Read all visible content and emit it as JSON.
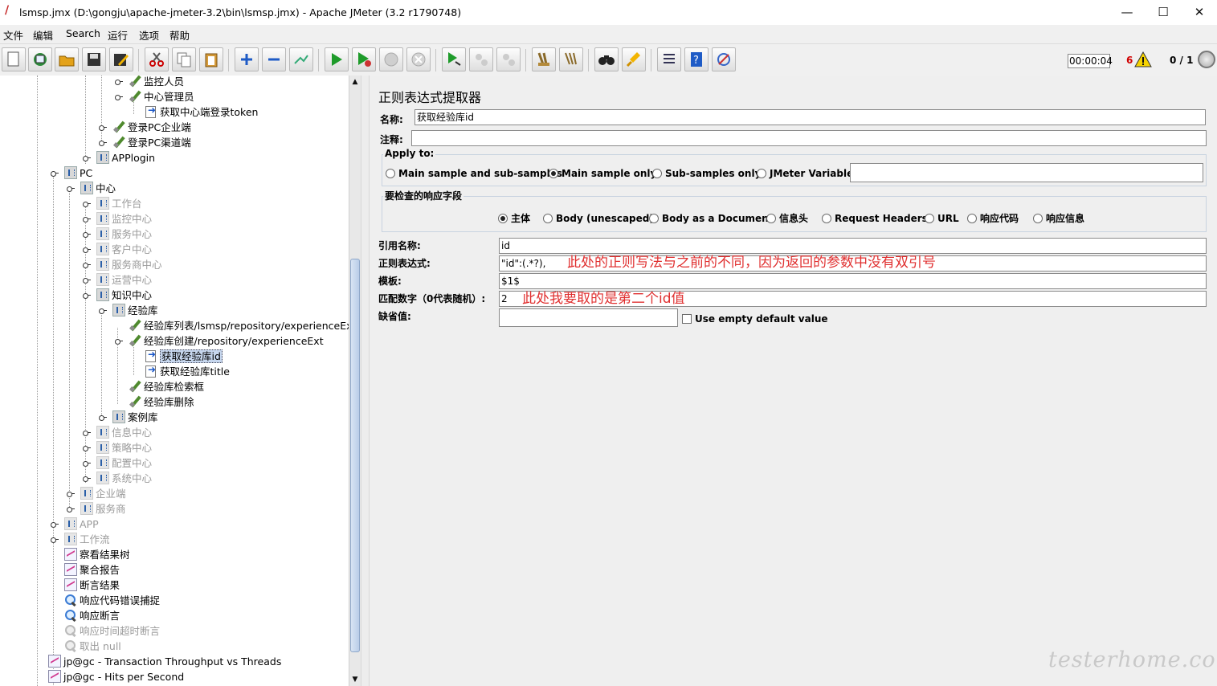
{
  "window": {
    "title": "lsmsp.jmx (D:\\gongju\\apache-jmeter-3.2\\bin\\lsmsp.jmx) - Apache JMeter (3.2 r1790748)",
    "minimize": "—",
    "maximize": "☐",
    "close": "✕"
  },
  "menu": [
    "文件",
    "编辑",
    "Search",
    "运行",
    "选项",
    "帮助"
  ],
  "toolbar": {
    "buttons": [
      "new",
      "templates",
      "open",
      "save",
      "save-as",
      "cut",
      "copy",
      "paste",
      "expand",
      "collapse",
      "toggle",
      "start",
      "start-no-pause",
      "stop",
      "shutdown",
      "remote-start",
      "remote-stop",
      "remote-shutdown",
      "clear",
      "clear-all",
      "search",
      "reset-search",
      "function-helper",
      "help",
      "log-viewer"
    ],
    "elapsed": "00:00:04",
    "warning_count": "6",
    "threads": "0 / 1"
  },
  "tree": {
    "nodes": [
      {
        "label": "监控人员",
        "icon": "pen-icon",
        "disabled": false,
        "expander": true
      },
      {
        "label": "中心管理员",
        "icon": "pen-icon",
        "disabled": false,
        "expander": true
      },
      {
        "label": "获取中心端登录token",
        "icon": "extractor-icon",
        "disabled": false,
        "expander": false
      },
      {
        "label": "登录PC企业端",
        "icon": "pen-icon",
        "disabled": false,
        "expander": true
      },
      {
        "label": "登录PC渠道端",
        "icon": "pen-icon",
        "disabled": false,
        "expander": true
      },
      {
        "label": "APPlogin",
        "icon": "controller-icon",
        "disabled": false,
        "expander": true
      },
      {
        "label": "PC",
        "icon": "controller-icon",
        "disabled": false,
        "expander": true
      },
      {
        "label": "中心",
        "icon": "controller-icon",
        "disabled": false,
        "expander": true
      },
      {
        "label": "工作台",
        "icon": "controller-icon",
        "disabled": true,
        "expander": true
      },
      {
        "label": "监控中心",
        "icon": "controller-icon",
        "disabled": true,
        "expander": true
      },
      {
        "label": "服务中心",
        "icon": "controller-icon",
        "disabled": true,
        "expander": true
      },
      {
        "label": "客户中心",
        "icon": "controller-icon",
        "disabled": true,
        "expander": true
      },
      {
        "label": "服务商中心",
        "icon": "controller-icon",
        "disabled": true,
        "expander": true
      },
      {
        "label": "运营中心",
        "icon": "controller-icon",
        "disabled": true,
        "expander": true
      },
      {
        "label": "知识中心",
        "icon": "controller-icon",
        "disabled": false,
        "expander": true
      },
      {
        "label": "经验库",
        "icon": "controller-icon",
        "disabled": false,
        "expander": true
      },
      {
        "label": "经验库列表/lsmsp/repository/experienceExt",
        "icon": "pen-icon",
        "disabled": false,
        "expander": false
      },
      {
        "label": "经验库创建/repository/experienceExt",
        "icon": "pen-icon",
        "disabled": false,
        "expander": true
      },
      {
        "label": "获取经验库id",
        "icon": "extractor-icon",
        "disabled": false,
        "expander": false,
        "selected": true
      },
      {
        "label": "获取经验库title",
        "icon": "extractor-icon",
        "disabled": false,
        "expander": false
      },
      {
        "label": "经验库检索框",
        "icon": "pen-icon",
        "disabled": false,
        "expander": false
      },
      {
        "label": "经验库删除",
        "icon": "pen-icon",
        "disabled": false,
        "expander": false
      },
      {
        "label": "案例库",
        "icon": "controller-icon",
        "disabled": false,
        "expander": true
      },
      {
        "label": "信息中心",
        "icon": "controller-icon",
        "disabled": true,
        "expander": true
      },
      {
        "label": "策略中心",
        "icon": "controller-icon",
        "disabled": true,
        "expander": true
      },
      {
        "label": "配置中心",
        "icon": "controller-icon",
        "disabled": true,
        "expander": true
      },
      {
        "label": "系统中心",
        "icon": "controller-icon",
        "disabled": true,
        "expander": true
      },
      {
        "label": "企业端",
        "icon": "controller-icon",
        "disabled": true,
        "expander": true
      },
      {
        "label": "服务商",
        "icon": "controller-icon",
        "disabled": true,
        "expander": true
      },
      {
        "label": "APP",
        "icon": "controller-icon",
        "disabled": true,
        "expander": true
      },
      {
        "label": "工作流",
        "icon": "controller-icon",
        "disabled": true,
        "expander": true
      },
      {
        "label": "察看结果树",
        "icon": "chart-icon",
        "disabled": false,
        "expander": false
      },
      {
        "label": "聚合报告",
        "icon": "chart-icon",
        "disabled": false,
        "expander": false
      },
      {
        "label": "断言结果",
        "icon": "chart-icon",
        "disabled": false,
        "expander": false
      },
      {
        "label": "响应代码错误捕捉",
        "icon": "magnifier-icon",
        "disabled": false,
        "expander": false
      },
      {
        "label": "响应断言",
        "icon": "magnifier-icon",
        "disabled": false,
        "expander": false
      },
      {
        "label": "响应时间超时断言",
        "icon": "magnifier-icon",
        "disabled": true,
        "expander": false
      },
      {
        "label": "取出 null",
        "icon": "magnifier-icon",
        "disabled": true,
        "expander": false
      },
      {
        "label": "jp@gc - Transaction Throughput vs Threads",
        "icon": "chart-icon",
        "disabled": false,
        "expander": false
      },
      {
        "label": "jp@gc - Hits per Second",
        "icon": "chart-icon",
        "disabled": false,
        "expander": false
      }
    ]
  },
  "editor": {
    "title": "正则表达式提取器",
    "name_label": "名称:",
    "name_value": "获取经验库id",
    "comment_label": "注释:",
    "comment_value": "",
    "apply_to": {
      "title": "Apply to:",
      "options": [
        "Main sample and sub-samples",
        "Main sample only",
        "Sub-samples only",
        "JMeter Variable"
      ],
      "selected": "Main sample only",
      "variable_value": ""
    },
    "field_check": {
      "title": "要检查的响应字段",
      "options": [
        "主体",
        "Body (unescaped)",
        "Body as a Document",
        "信息头",
        "Request Headers",
        "URL",
        "响应代码",
        "响应信息"
      ],
      "selected": "主体"
    },
    "ref_name_label": "引用名称:",
    "ref_name_value": "id",
    "regex_label": "正则表达式:",
    "regex_value": "\"id\":(.*?),",
    "template_label": "模板:",
    "template_value": "$1$",
    "match_label": "匹配数字（0代表随机）:",
    "match_value": "2",
    "default_label": "缺省值:",
    "default_value": "",
    "use_empty_default": "Use empty default value",
    "annotation_regex": "此处的正则写法与之前的不同，因为返回的参数中没有双引号",
    "annotation_match": "此处我要取的是第二个id值"
  },
  "watermark": "testerhome.com"
}
